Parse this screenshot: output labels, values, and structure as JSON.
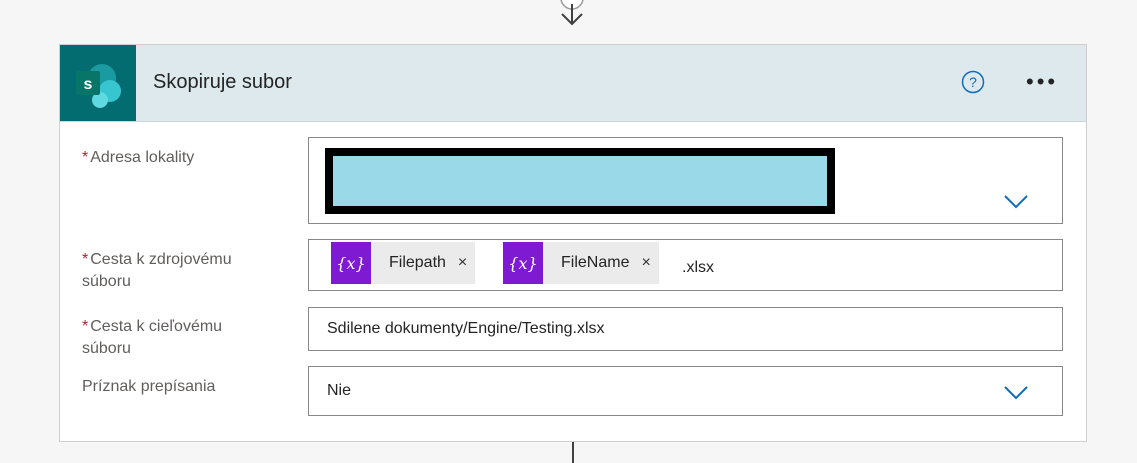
{
  "action": {
    "title": "Skopiruje subor",
    "help_icon": "question-circle-icon",
    "more_icon": "ellipsis-icon",
    "more_label": "•••",
    "app_icon": "sharepoint-icon",
    "app_icon_letter": "s"
  },
  "fields": {
    "required_mark": "*",
    "site": {
      "label": "Adresa lokality",
      "value_redacted": true
    },
    "source": {
      "label_line1": "Cesta k zdrojovému",
      "label_line2": "súboru",
      "tokens": [
        {
          "icon": "{x}",
          "label": "Filepath",
          "remove": "×"
        },
        {
          "icon": "{x}",
          "label": "FileName",
          "remove": "×"
        }
      ],
      "suffix": ".xlsx"
    },
    "destination": {
      "label_line1": "Cesta k cieľovému",
      "label_line2": "súboru",
      "value": "Sdilene dokumenty/Engine/Testing.xlsx"
    },
    "overwrite": {
      "label": "Príznak prepísania",
      "value": "Nie"
    }
  },
  "colors": {
    "header_bg": "#dde9ec",
    "app_icon_bg": "#036c70",
    "token_icon_bg": "#7e1ad2",
    "chevron": "#0f6cbd",
    "required": "#a4262c"
  }
}
